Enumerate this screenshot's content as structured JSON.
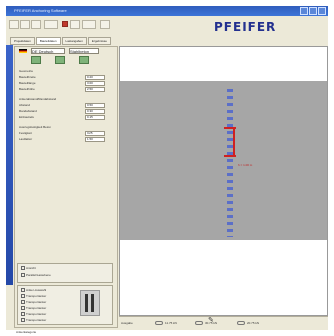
{
  "window": {
    "caption": "PFEIFER Anchoring Software"
  },
  "header": {
    "logo": "PFEIFER"
  },
  "tabs": [
    {
      "label": "Projektdaten"
    },
    {
      "label": "Bauteildaten"
    },
    {
      "label": "Lastangaben"
    },
    {
      "label": "Ergebnisse"
    }
  ],
  "left": {
    "combo1": "DE Deutsch",
    "combo2": "Stahlbeton",
    "section1": "Geometrie",
    "rows1": [
      {
        "label": "Bauteilbreite",
        "value": "0.20"
      },
      {
        "label": "Bauteillänge",
        "value": "3.00"
      },
      {
        "label": "Bauteilhöhe",
        "value": "2.50"
      }
    ],
    "section2": "Ankerabstand/Randabstand",
    "rows2": [
      {
        "label": "Abstand",
        "value": "0.50"
      },
      {
        "label": "Randabstand",
        "value": "0.30"
      },
      {
        "label": "Einbautiefe",
        "value": "0.15"
      }
    ],
    "section3": "Auszugsfestigkeit Beton",
    "rows3": [
      {
        "label": "Festigkeit",
        "value": "C25"
      },
      {
        "label": "Lastfaktor",
        "value": "1.50"
      }
    ],
    "box1_title": "Ansicht",
    "box1_opt": "Parallel/Lastebene",
    "box2_title": "Anker-Auswahl",
    "anchors": [
      "Transportanker",
      "Transportanker",
      "Transportanker",
      "Transportanker",
      "Transportanker"
    ],
    "bottom_label": "Ankerkategorie"
  },
  "drawing": {
    "dim_label": "h = 1.00 m"
  },
  "status": {
    "left": "Ausgabe",
    "mid1": "11.75 kN",
    "mid2": "30.75 kN",
    "right": "20.75 kN"
  }
}
